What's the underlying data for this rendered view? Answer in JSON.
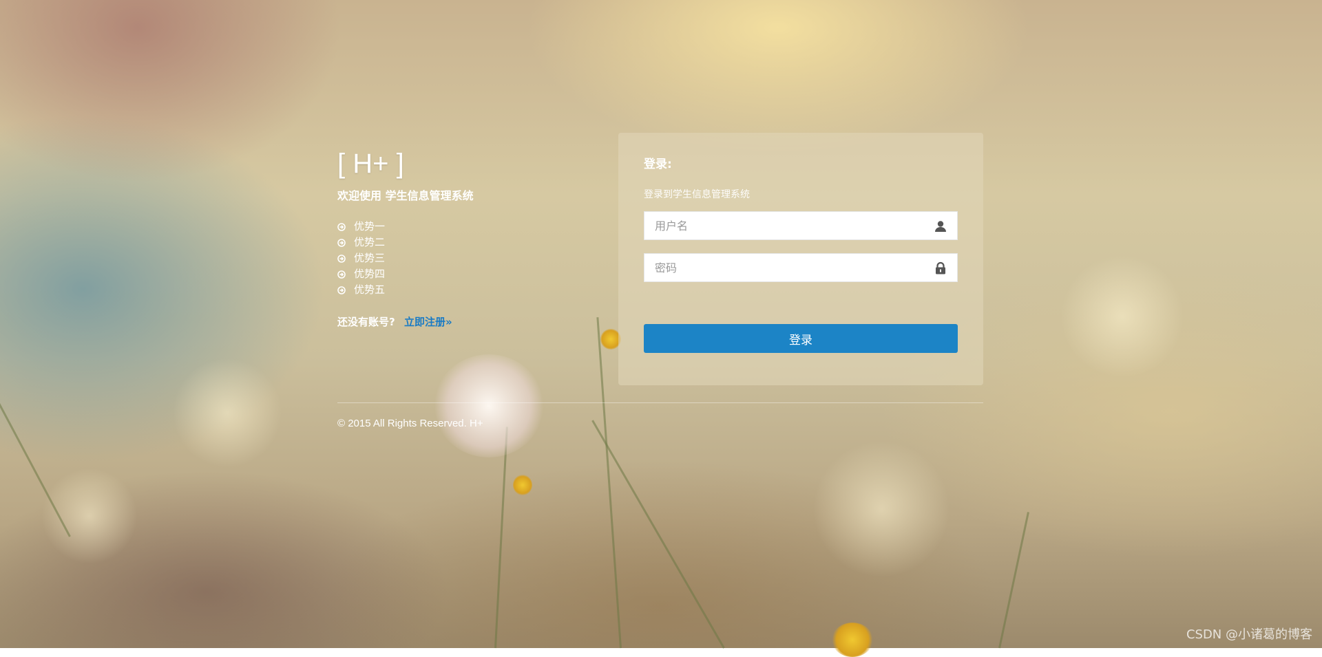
{
  "brand": {
    "logo": "[ H+ ]",
    "welcome": "欢迎使用 学生信息管理系统"
  },
  "features": [
    {
      "label": "优势一",
      "icon": "arrow-circle-right-icon"
    },
    {
      "label": "优势二",
      "icon": "arrow-circle-right-icon"
    },
    {
      "label": "优势三",
      "icon": "arrow-circle-right-icon"
    },
    {
      "label": "优势四",
      "icon": "arrow-circle-right-icon"
    },
    {
      "label": "优势五",
      "icon": "arrow-circle-right-icon"
    }
  ],
  "signup": {
    "prompt": "还没有账号?",
    "link": "立即注册»"
  },
  "login": {
    "title": "登录:",
    "subtitle": "登录到学生信息管理系统",
    "username_placeholder": "用户名",
    "username_icon": "user-icon",
    "password_placeholder": "密码",
    "password_icon": "lock-icon",
    "button": "登录"
  },
  "footer": {
    "copyright": "© 2015 All Rights Reserved. H+"
  },
  "watermark": "CSDN @小诸葛的博客",
  "colors": {
    "accent": "#1c84c6",
    "link": "#1a7bc4",
    "text": "#ffffff"
  }
}
